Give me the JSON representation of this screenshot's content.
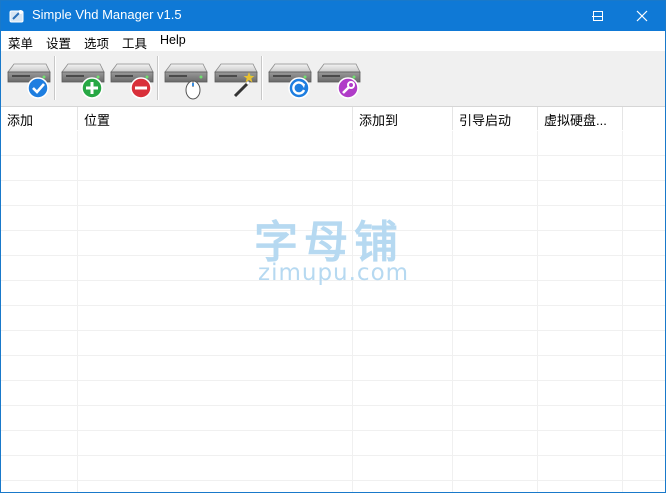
{
  "window": {
    "title": "Simple Vhd Manager v1.5",
    "accent_color": "#0f79d6"
  },
  "menu": {
    "items": [
      "菜单",
      "设置",
      "选项",
      "工具",
      "Help"
    ]
  },
  "toolbar": {
    "buttons": [
      {
        "name": "apply",
        "icon": "drive-checkmark-icon",
        "badge_color": "#1e7ee0"
      },
      {
        "name": "add",
        "icon": "drive-plus-icon",
        "badge_color": "#27a844"
      },
      {
        "name": "remove",
        "icon": "drive-minus-icon",
        "badge_color": "#d9303a"
      },
      {
        "name": "mount",
        "icon": "drive-mouse-icon",
        "badge_color": "#ffffff"
      },
      {
        "name": "create",
        "icon": "drive-wand-icon",
        "badge_color": "#e8c130"
      },
      {
        "name": "refresh",
        "icon": "drive-refresh-icon",
        "badge_color": "#1e7ee0"
      },
      {
        "name": "tools",
        "icon": "drive-wrench-icon",
        "badge_color": "#b03cc8"
      }
    ]
  },
  "list": {
    "columns": [
      "添加",
      "位置",
      "添加到",
      "引导启动",
      "虚拟硬盘..."
    ],
    "rows": []
  },
  "watermark": {
    "cn": "字母铺",
    "en": "zimupu.com"
  }
}
